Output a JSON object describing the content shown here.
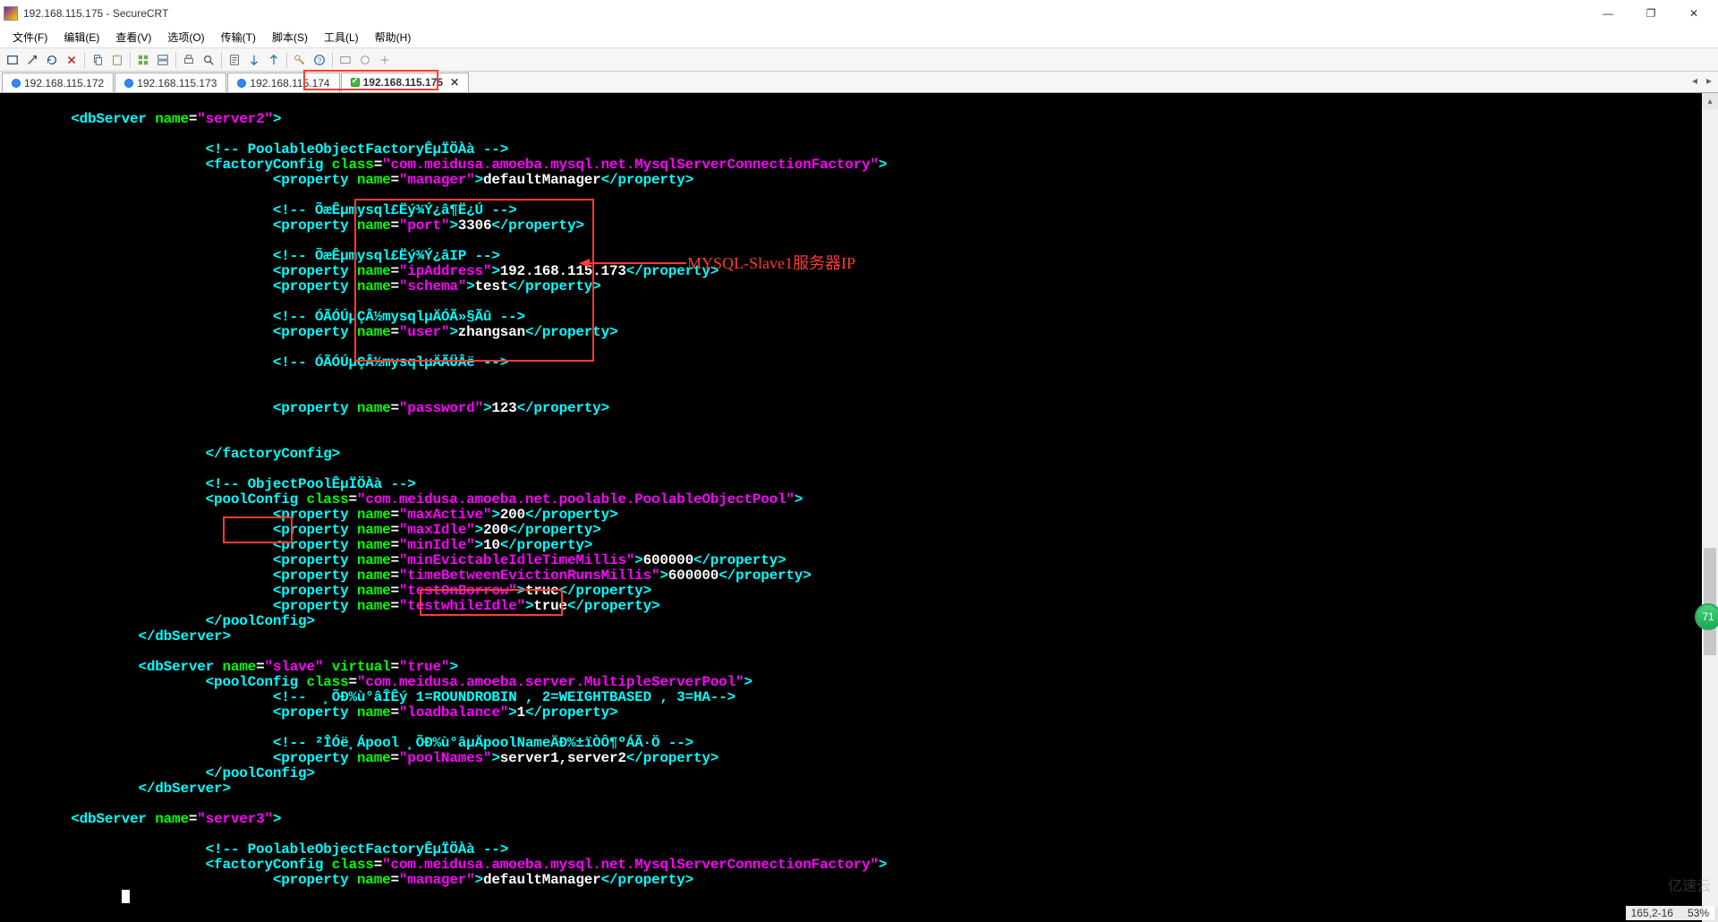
{
  "window": {
    "title": "192.168.115.175 - SecureCRT"
  },
  "menu": {
    "file": "文件(F)",
    "edit": "编辑(E)",
    "view": "查看(V)",
    "options": "选项(O)",
    "transfer": "传输(T)",
    "script": "脚本(S)",
    "tools": "工具(L)",
    "help": "帮助(H)"
  },
  "tabs": {
    "items": [
      {
        "label": "192.168.115.172"
      },
      {
        "label": "192.168.115.173"
      },
      {
        "label": "192.168.115.174"
      },
      {
        "label": "192.168.115.175"
      }
    ],
    "active_index": 3
  },
  "status": {
    "pos": "165,2-16",
    "percent": "53%"
  },
  "annotations": {
    "slave1_ip": "MYSQL-Slave1服务器IP"
  },
  "terminal": {
    "server2_open1": "<dbServer ",
    "server2_open2": "name",
    "server2_open3": "=",
    "server2_open4": "\"server2\"",
    "server2_open5": ">",
    "cmt_poolfactory": "<!-- PoolableObjectFactoryÊµÏÖÀà -->",
    "fc_open1": "<factoryConfig ",
    "fc_open2": "class",
    "fc_open3": "=",
    "fc_open4": "\"com.meidusa.amoeba.mysql.net.MysqlServerConnectionFactory\"",
    "fc_open5": ">",
    "p_mgr1": "<property ",
    "p_mgr2": "name",
    "p_mgr3": "=",
    "p_mgr4": "\"manager\"",
    "p_mgr5": ">",
    "p_mgr6": "defaultManager",
    "p_mgr7": "</property>",
    "cmt_port": "<!-- ÕæÊµmysql£Ëý¾Ý¿â¶Ë¿Ú -->",
    "p_port1": "<property ",
    "p_port2": "name",
    "p_port3": "=",
    "p_port4": "\"port\"",
    "p_port5": ">",
    "p_port6": "3306",
    "p_port7": "</property>",
    "cmt_ip": "<!-- ÕæÊµmysql£Ëý¾Ý¿âIP -->",
    "p_ip1": "<property ",
    "p_ip2": "name",
    "p_ip3": "=",
    "p_ip4": "\"ipAddress\"",
    "p_ip5": ">",
    "p_ip6": "192.168.115.173",
    "p_ip7": "</property>",
    "p_sch1": "<property ",
    "p_sch2": "name",
    "p_sch3": "=",
    "p_sch4": "\"schema\"",
    "p_sch5": ">",
    "p_sch6": "test",
    "p_sch7": "</property>",
    "cmt_user": "<!-- ÓÃÓÚµÇÂ½mysqlµÄÓÃ»§Ãû -->",
    "p_usr1": "<property ",
    "p_usr2": "name",
    "p_usr3": "=",
    "p_usr4": "\"user\"",
    "p_usr5": ">",
    "p_usr6": "zhangsan",
    "p_usr7": "</property>",
    "cmt_pwd": "<!-- ÓÃÓÚµÇÂ½mysqlµÄÃÜÂë -->",
    "p_pwd1": "<property ",
    "p_pwd2": "name",
    "p_pwd3": "=",
    "p_pwd4": "\"password\"",
    "p_pwd5": ">",
    "p_pwd6": "123",
    "p_pwd7": "</property>",
    "fc_close": "</factoryConfig>",
    "cmt_objpool": "<!-- ObjectPoolÊµÏÖÀà -->",
    "pc_open1": "<poolConfig ",
    "pc_open2": "class",
    "pc_open3": "=",
    "pc_open4": "\"com.meidusa.amoeba.net.poolable.PoolableObjectPool\"",
    "pc_open5": ">",
    "p_ma1": "<property ",
    "p_ma2": "name",
    "p_ma3": "=",
    "p_ma4": "\"maxActive\"",
    "p_ma5": ">",
    "p_ma6": "200",
    "p_ma7": "</property>",
    "p_mi1": "<property ",
    "p_mi2": "name",
    "p_mi3": "=",
    "p_mi4": "\"maxIdle\"",
    "p_mi5": ">",
    "p_mi6": "200",
    "p_mi7": "</property>",
    "p_mn1": "<property ",
    "p_mn2": "name",
    "p_mn3": "=",
    "p_mn4": "\"minIdle\"",
    "p_mn5": ">",
    "p_mn6": "10",
    "p_mn7": "</property>",
    "p_me1": "<property ",
    "p_me2": "name",
    "p_me3": "=",
    "p_me4": "\"minEvictableIdleTimeMillis\"",
    "p_me5": ">",
    "p_me6": "600000",
    "p_me7": "</property>",
    "p_tb1": "<property ",
    "p_tb2": "name",
    "p_tb3": "=",
    "p_tb4": "\"timeBetweenEvictionRunsMillis\"",
    "p_tb5": ">",
    "p_tb6": "600000",
    "p_tb7": "</property>",
    "p_to1": "<property ",
    "p_to2": "name",
    "p_to3": "=",
    "p_to4": "\"testOnBorrow\"",
    "p_to5": ">",
    "p_to6": "true",
    "p_to7": "</property>",
    "p_tw1": "<property ",
    "p_tw2": "name",
    "p_tw3": "=",
    "p_tw4": "\"testwhileIdle\"",
    "p_tw5": ">",
    "p_tw6": "true",
    "p_tw7": "</property>",
    "pc_close": "</poolConfig>",
    "server2_close": "</dbServer>",
    "svslave1": "<dbServer ",
    "svslave2": "name",
    "svslave3": "=",
    "svslave4": "\"slave\"",
    "svslave5": " virtual",
    "svslave6": "=",
    "svslave7": "\"true\"",
    "svslave8": ">",
    "msp1": "<poolConfig ",
    "msp2": "class",
    "msp3": "=",
    "msp4": "\"com.meidusa.amoeba.server.MultipleServerPool\"",
    "msp5": ">",
    "cmt_lb": "<!--  ¸ÕÐ%ù°âÎÊý 1=ROUNDROBIN , 2=WEIGHTBASED , 3=HA-->",
    "p_lb1": "<property ",
    "p_lb2": "name",
    "p_lb3": "=",
    "p_lb4": "\"loadbalance\"",
    "p_lb5": ">",
    "p_lb6": "1",
    "p_lb7": "</property>",
    "cmt_pn": "<!-- ²ÎÓë¸Ápool ¸ÕÐ%ù°âµÄpoolNameÄÐ%±ïÒÔ¶ºÁÃ·Ö -->",
    "p_pn1": "<property ",
    "p_pn2": "name",
    "p_pn3": "=",
    "p_pn4": "\"poolNames\"",
    "p_pn5": ">",
    "p_pn6": "server1,server2",
    "p_pn7": "</property>",
    "msp_close": "</poolConfig>",
    "svslave_close": "</dbServer>",
    "server3_open1": "<dbServer ",
    "server3_open2": "name",
    "server3_open3": "=",
    "server3_open4": "\"server3\"",
    "server3_open5": ">",
    "cmt_poolfactory2": "<!-- PoolableObjectFactoryÊµÏÖÀà -->",
    "fc2_open1": "<factoryConfig ",
    "fc2_open2": "class",
    "fc2_open3": "=",
    "fc2_open4": "\"com.meidusa.amoeba.mysql.net.MysqlServerConnectionFactory\"",
    "fc2_open5": ">",
    "p_mgr2_1": "<property ",
    "p_mgr2_2": "name",
    "p_mgr2_3": "=",
    "p_mgr2_4": "\"manager\"",
    "p_mgr2_5": ">",
    "p_mgr2_6": "defaultManager",
    "p_mgr2_7": "</property>"
  },
  "float_badge": "71"
}
